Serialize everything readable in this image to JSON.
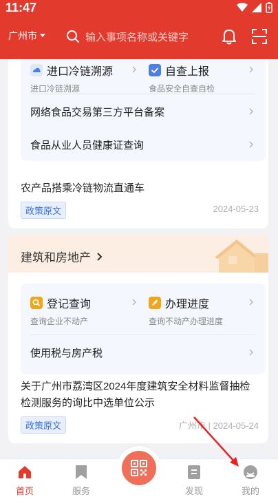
{
  "status": {
    "time": "11:47"
  },
  "header": {
    "city": "广州市",
    "search_placeholder": "输入事项名称或关键字"
  },
  "card1": {
    "services": [
      {
        "title": "进口冷链溯源",
        "sub": "进口冷链溯源",
        "icon": "cloud-icon",
        "icon_color": "#4b7fe3"
      },
      {
        "title": "自查上报",
        "sub": "食品安全自查自检",
        "icon": "check-icon",
        "icon_color": "#4b7fe3"
      }
    ],
    "rows": [
      "网络食品交易第三方平台备案",
      "食品从业人员健康证查询"
    ],
    "news": {
      "title": "农产品搭乘冷链物流直通车",
      "tag": "政策原文",
      "date": "2024-05-23"
    }
  },
  "section2": {
    "title": "建筑和房地产",
    "services": [
      {
        "title": "登记查询",
        "sub": "查询企业不动产",
        "icon": "search-doc-icon",
        "icon_color": "#f2a51a"
      },
      {
        "title": "办理进度",
        "sub": "查询不动产办理进度",
        "icon": "pen-icon",
        "icon_color": "#f2a51a"
      }
    ],
    "rows": [
      "使用税与房产税"
    ],
    "news": {
      "title": "关于广州市荔湾区2024年度建筑安全材料监督抽检检测服务的询比中选单位公示",
      "tag": "政策原文",
      "source": "广州市",
      "date": "2024-05-24"
    }
  },
  "bottom_nav": {
    "items": [
      {
        "label": "首页",
        "icon": "home-icon",
        "active": true
      },
      {
        "label": "服务",
        "icon": "bookmark-icon",
        "active": false
      },
      {
        "label": "",
        "icon": "qr-code-icon",
        "active": false
      },
      {
        "label": "发现",
        "icon": "document-icon",
        "active": false
      },
      {
        "label": "我的",
        "icon": "profile-icon",
        "active": false
      }
    ]
  },
  "colors": {
    "brand": "#e23b2d",
    "tag_blue": "#3b6fd8",
    "section_bg": "#fdeee3"
  }
}
